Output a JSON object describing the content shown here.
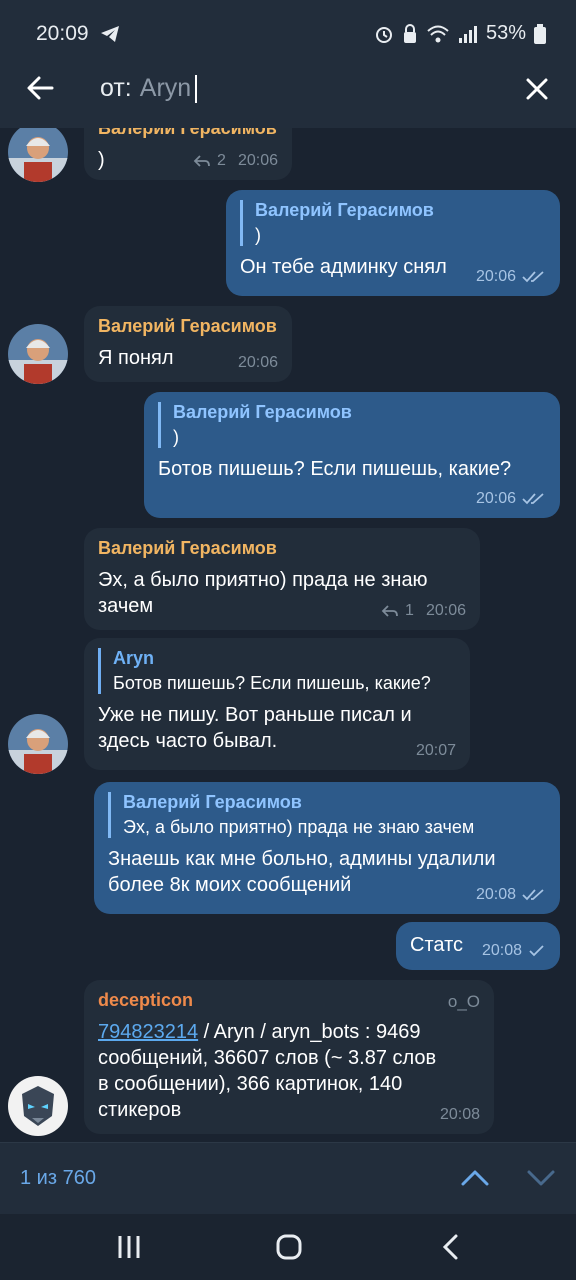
{
  "status_bar": {
    "time": "20:09",
    "battery": "53%"
  },
  "search": {
    "prefix": "от:",
    "value": "Aryn"
  },
  "messages": [
    {
      "sender": "Валерий Герасимов",
      "text": ")",
      "replies": "2",
      "time": "20:06"
    },
    {
      "reply_to": "Валерий Герасимов",
      "reply_text": ")",
      "text": "Он тебе админку снял",
      "time": "20:06"
    },
    {
      "sender": "Валерий Герасимов",
      "text": "Я понял",
      "time": "20:06"
    },
    {
      "reply_to": "Валерий Герасимов",
      "reply_text": ")",
      "text": "Ботов пишешь? Если пишешь, какие?",
      "time": "20:06"
    },
    {
      "sender": "Валерий Герасимов",
      "text_line1": "Эх, а было приятно) прада не знаю",
      "text_line2": "зачем",
      "replies": "1",
      "time": "20:06"
    },
    {
      "reply_to": "Aryn",
      "reply_text": "Ботов пишешь? Если пишешь, какие?",
      "text_line1": "Уже не пишу. Вот раньше писал и",
      "text_line2": "здесь часто бывал.",
      "time": "20:07"
    },
    {
      "reply_to": "Валерий Герасимов",
      "reply_text": "Эх, а было приятно) прада не знаю зачем",
      "text_line1": "Знаешь как мне больно, админы удалили",
      "text_line2": "более 8к моих сообщений",
      "time": "20:08"
    },
    {
      "text": "Статс",
      "time": "20:08"
    },
    {
      "sender": "decepticon",
      "badge": "o_O",
      "link": "794823214",
      "text_line1_rest": " / Aryn / aryn_bots : 9469",
      "text_line2": "сообщений, 36607 слов (~ 3.87 слов",
      "text_line3": "в сообщении), 366 картинок, 140",
      "text_line4": "стикеров",
      "time": "20:08"
    }
  ],
  "bottom_bar": {
    "counter": "1 из 760"
  },
  "colors": {
    "background": "#1a2330",
    "incoming_bubble": "#222d3a",
    "outgoing_bubble": "#2d5a8a",
    "accent": "#6aa8e8",
    "sender_name": "#f1b562"
  }
}
